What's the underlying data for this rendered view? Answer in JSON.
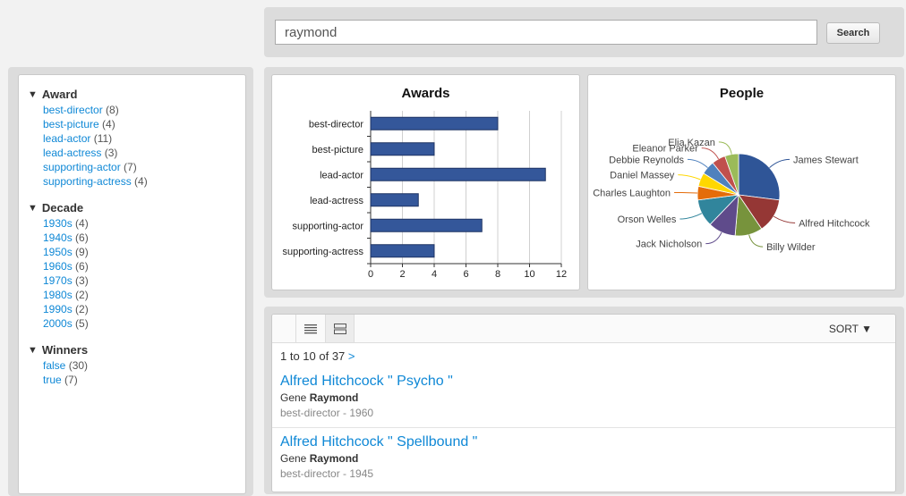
{
  "search": {
    "value": "raymond",
    "button_label": "Search"
  },
  "facets": [
    {
      "title": "Award",
      "items": [
        {
          "label": "best-director",
          "count": "(8)"
        },
        {
          "label": "best-picture",
          "count": "(4)"
        },
        {
          "label": "lead-actor",
          "count": "(11)"
        },
        {
          "label": "lead-actress",
          "count": "(3)"
        },
        {
          "label": "supporting-actor",
          "count": "(7)"
        },
        {
          "label": "supporting-actress",
          "count": "(4)"
        }
      ]
    },
    {
      "title": "Decade",
      "items": [
        {
          "label": "1930s",
          "count": "(4)"
        },
        {
          "label": "1940s",
          "count": "(6)"
        },
        {
          "label": "1950s",
          "count": "(9)"
        },
        {
          "label": "1960s",
          "count": "(6)"
        },
        {
          "label": "1970s",
          "count": "(3)"
        },
        {
          "label": "1980s",
          "count": "(2)"
        },
        {
          "label": "1990s",
          "count": "(2)"
        },
        {
          "label": "2000s",
          "count": "(5)"
        }
      ]
    },
    {
      "title": "Winners",
      "items": [
        {
          "label": "false",
          "count": "(30)"
        },
        {
          "label": "true",
          "count": "(7)"
        }
      ]
    }
  ],
  "chart_data": [
    {
      "type": "bar",
      "title": "Awards",
      "categories": [
        "best-director",
        "best-picture",
        "lead-actor",
        "lead-actress",
        "supporting-actor",
        "supporting-actress"
      ],
      "values": [
        8,
        4,
        11,
        3,
        7,
        4
      ],
      "xlim": [
        0,
        12
      ],
      "ticks": [
        0,
        2,
        4,
        6,
        8,
        10,
        12
      ],
      "grid": true,
      "color": "#34579a"
    },
    {
      "type": "pie",
      "title": "People",
      "labels": [
        "James Stewart",
        "Alfred Hitchcock",
        "Billy Wilder",
        "Jack Nicholson",
        "Orson Welles",
        "Charles Laughton",
        "Daniel Massey",
        "Debbie Reynolds",
        "Eleanor Parker",
        "Elia Kazan"
      ],
      "values": [
        10,
        5,
        4,
        4,
        4,
        2,
        2,
        2,
        2,
        2
      ],
      "colors": [
        "#2f5597",
        "#953735",
        "#77933c",
        "#5f4b8b",
        "#31859c",
        "#e46c0a",
        "#ffd700",
        "#4f81bd",
        "#c0504d",
        "#9bbb59"
      ]
    }
  ],
  "results": {
    "paging_text": "1 to 10 of 37",
    "next_label": ">",
    "sort_label": "SORT ▼",
    "items": [
      {
        "title": "Alfred Hitchcock \" Psycho \"",
        "prefix": "Gene",
        "highlight": "Raymond",
        "meta": "best-director - 1960"
      },
      {
        "title": "Alfred Hitchcock \" Spellbound \"",
        "prefix": "Gene",
        "highlight": "Raymond",
        "meta": "best-director - 1945"
      }
    ]
  }
}
